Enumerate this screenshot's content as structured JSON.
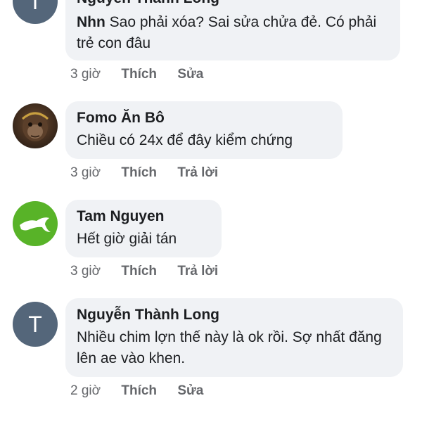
{
  "comments": [
    {
      "author": "Nguyễn Thành Long",
      "avatar_letter": "T",
      "mention": "Nhn",
      "text": "Sao phải xóa? Sai sửa chửa đẻ. Có phải trẻ con đâu",
      "time": "3 giờ",
      "like_label": "Thích",
      "action_label": "Sửa"
    },
    {
      "author": "Fomo Ăn Bô",
      "avatar_icon": "monkey-warrior-avatar-icon",
      "text": "Chiều có 24x để đây kiểm chứng",
      "time": "3 giờ",
      "like_label": "Thích",
      "action_label": "Trả lời"
    },
    {
      "author": "Tam Nguyen",
      "avatar_icon": "puma-logo-icon",
      "text": "Hết giờ giải tán",
      "time": "3 giờ",
      "like_label": "Thích",
      "action_label": "Trả lời"
    },
    {
      "author": "Nguyễn Thành Long",
      "avatar_letter": "T",
      "text": "Nhiều chim lợn thế này là ok rồi. Sợ nhất đăng lên ae vào khen.",
      "time": "2 giờ",
      "like_label": "Thích",
      "action_label": "Sửa"
    }
  ],
  "colors": {
    "bubble": "#f0f2f5",
    "avatar_letter_bg": "#54667a",
    "puma_bg": "#58b328",
    "meta_text": "#65676b",
    "body_text": "#1c1e21"
  }
}
